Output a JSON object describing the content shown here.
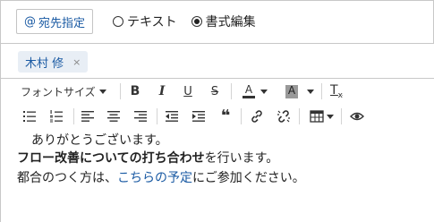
{
  "address_button": {
    "icon": "@",
    "label": "宛先指定"
  },
  "format_options": [
    {
      "label": "テキスト",
      "checked": false
    },
    {
      "label": "書式編集",
      "checked": true
    }
  ],
  "recipients": [
    {
      "name": "木村 修",
      "remove": "×"
    }
  ],
  "toolbar": {
    "font_size_label": "フォントサイズ",
    "bold": "B",
    "italic": "I",
    "underline": "U",
    "strike": "S",
    "font_color": "A",
    "bg_color": "A",
    "clear_format": "T",
    "clear_format_sub": "x",
    "quote": "❝"
  },
  "body": {
    "line1": "ありがとうございます。",
    "line2_bold": "フロー改善についての打ち合わせ",
    "line2_rest": "を行います。",
    "line3_pre": "都合のつく方は、",
    "line3_link": "こちらの予定",
    "line3_post": "にご参加ください。"
  }
}
